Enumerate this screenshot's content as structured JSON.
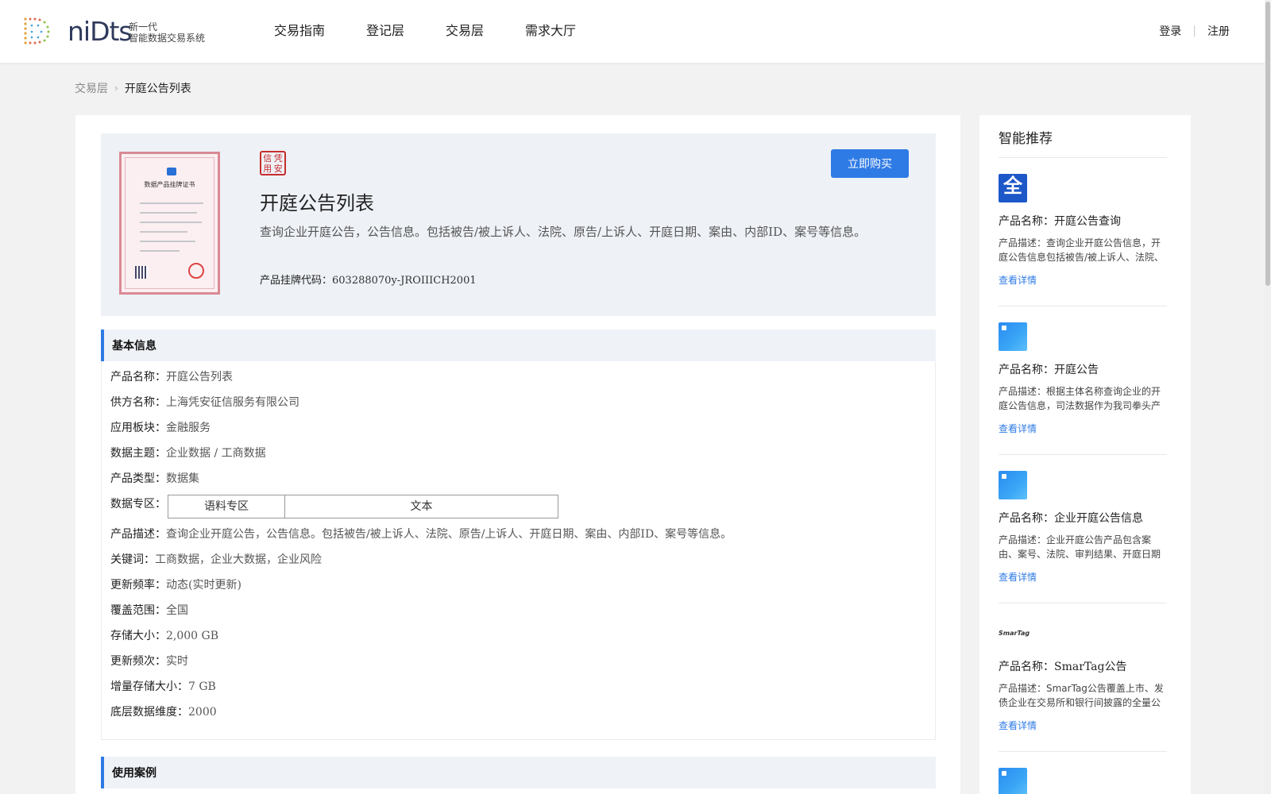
{
  "header": {
    "logo_word": "niDts",
    "logo_sub_line1": "新一代",
    "logo_sub_line2": "智能数据交易系统",
    "nav": [
      "交易指南",
      "登记层",
      "交易层",
      "需求大厅"
    ],
    "login": "登录",
    "register": "注册"
  },
  "breadcrumb": {
    "parent": "交易层",
    "current": "开庭公告列表"
  },
  "product": {
    "certificate_title": "数据产品挂牌证书",
    "stamp_chars": [
      "信",
      "凭",
      "用",
      "安"
    ],
    "title": "开庭公告列表",
    "description": "查询企业开庭公告，公告信息。包括被告/被上诉人、法院、原告/上诉人、开庭日期、案由、内部ID、案号等信息。",
    "code_label": "产品挂牌代码：",
    "code": "603288070y-JROIIICH2001",
    "buy_button": "立即购买"
  },
  "basic_info": {
    "heading": "基本信息",
    "name_label": "产品名称：",
    "name": "开庭公告列表",
    "supplier_label": "供方名称：",
    "supplier": "上海凭安征信服务有限公司",
    "sector_label": "应用板块：",
    "sector": "金融服务",
    "theme_label": "数据主题：",
    "theme": "企业数据 / 工商数据",
    "type_label": "产品类型：",
    "type": "数据集",
    "zone_label": "数据专区：",
    "zone_name": "语料专区",
    "zone_value": "文本",
    "desc_label": "产品描述：",
    "desc": "查询企业开庭公告，公告信息。包括被告/被上诉人、法院、原告/上诉人、开庭日期、案由、内部ID、案号等信息。",
    "keywords_label": "关键词：",
    "keywords": "工商数据，企业大数据，企业风险",
    "frequency_label": "更新频率：",
    "frequency": "动态(实时更新)",
    "coverage_label": "覆盖范围：",
    "coverage": "全国",
    "storage_label": "存储大小：",
    "storage": "2,000 GB",
    "update_label": "更新频次：",
    "update": "实时",
    "incr_label": "增量存储大小：",
    "incr": "7 GB",
    "dims_label": "底层数据维度：",
    "dims": "2000"
  },
  "usage": {
    "heading": "使用案例"
  },
  "sidebar": {
    "title": "智能推荐",
    "items": [
      {
        "thumb_text": "全",
        "name": "产品名称：开庭公告查询",
        "desc": "产品描述：查询企业开庭公告信息，开庭公告信息包括被告/被上诉人、法院、原告/上诉人、开庭日期、案由、内部ID、案号等信息",
        "link": "查看详情"
      },
      {
        "name": "产品名称：开庭公告",
        "desc": "产品描述：根据主体名称查询企业的开庭公告信息，司法数据作为我司拳头产品",
        "link": "查看详情"
      },
      {
        "name": "产品名称：企业开庭公告信息",
        "desc": "产品描述：企业开庭公告产品包含案由、案号、法院、审判结果、开庭日期等信息",
        "link": "查看详情"
      },
      {
        "thumb_text": "SmarTag",
        "name": "产品名称：SmarTag公告",
        "desc": "产品描述：SmarTag公告覆盖上市、发债企业在交易所和银行间披露的全量公告信息",
        "link": "查看详情"
      }
    ]
  },
  "colors": {
    "accent": "#2f7be5",
    "stamp": "#c62d2d"
  }
}
